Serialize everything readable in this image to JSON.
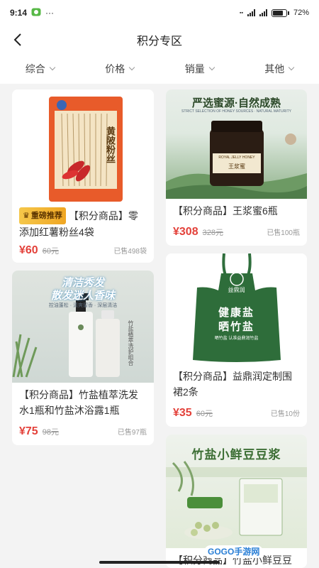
{
  "status": {
    "time": "9:14",
    "dots": "···",
    "battery": "72%"
  },
  "nav": {
    "title": "积分专区"
  },
  "filters": [
    {
      "label": "综合"
    },
    {
      "label": "价格"
    },
    {
      "label": "销量"
    },
    {
      "label": "其他"
    }
  ],
  "products": [
    {
      "badge": "重磅推荐",
      "name": "【积分商品】零添加红薯粉丝4袋",
      "price": "¥60",
      "orig": "60元",
      "sold": "已售498袋",
      "image_text": "黄陂粉丝"
    },
    {
      "name": "【积分商品】王浆蜜6瓶",
      "price": "¥308",
      "orig": "328元",
      "sold": "已售100瓶",
      "image_title": "严选蜜源·自然成熟",
      "image_sub": "STRICT SELECTION OF HONEY SOURCES · NATURAL MATURITY",
      "label_en": "ROYAL JELLY HONEY",
      "label_cn": "王浆蜜"
    },
    {
      "name": "【积分商品】竹盐植萃洗发水1瓶和竹盐沐浴露1瓶",
      "price": "¥75",
      "orig": "98元",
      "sold": "已售97瓶",
      "image_title_1": "清洁秀发",
      "image_title_2": "散发迷人香味",
      "image_sub": "控油蓬松 · 清爽留香 · 深层清洁",
      "side_text": "竹盐植萃洗护组合"
    },
    {
      "name": "【积分商品】益鼎润定制围裙2条",
      "price": "¥35",
      "orig": "60元",
      "sold": "已售10份",
      "apron_brand": "益鼎润",
      "apron_line1": "健康盐",
      "apron_line2": "晒竹盐",
      "apron_small": "晒竹盐 认准益鼎润竹盐"
    },
    {
      "image_title": "竹盐小鲜豆豆浆",
      "name": "【积分商品】竹盐小鲜豆豆浆"
    }
  ],
  "watermark": "GOGO手游网"
}
